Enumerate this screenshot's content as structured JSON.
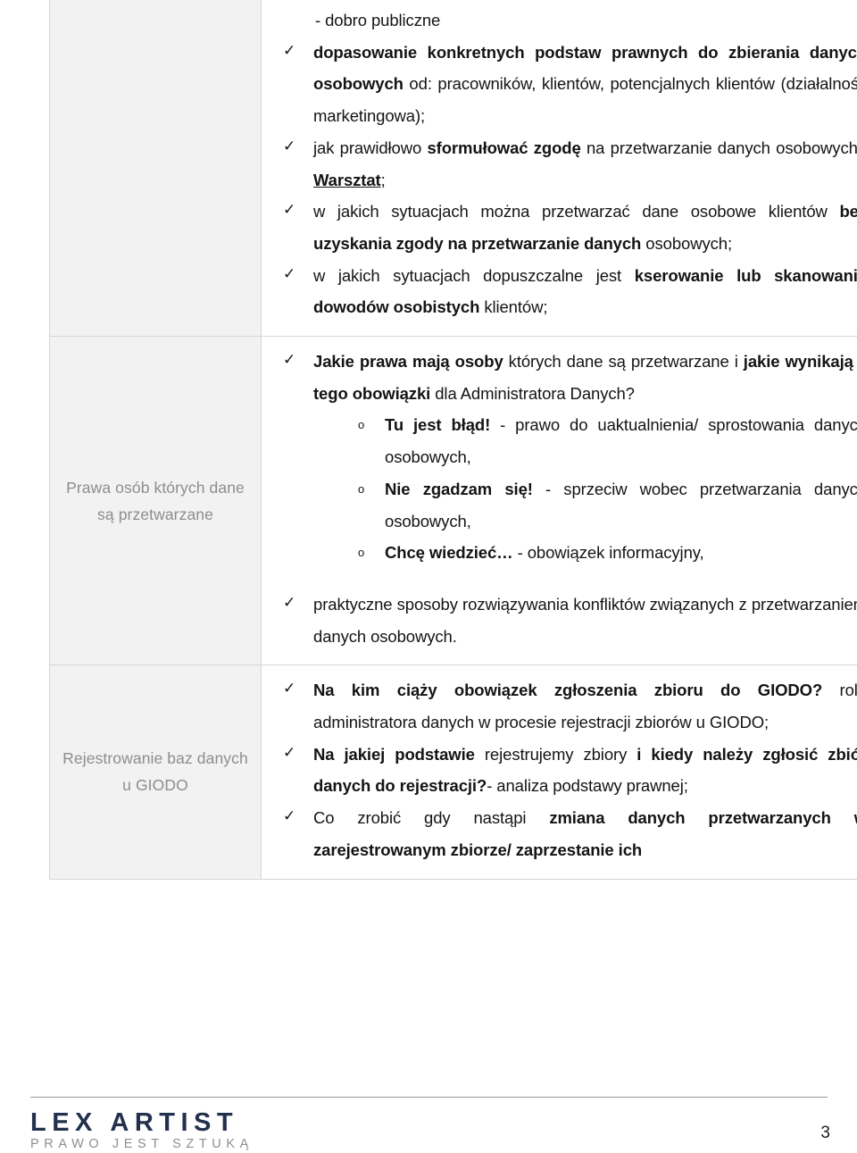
{
  "document": {
    "page_number": "3",
    "footer": {
      "logo_main": "LEX ARTIST",
      "logo_sub": "PRAWO JEST SZTUKĄ"
    }
  },
  "table": {
    "rows": [
      {
        "label": "",
        "blocks": [
          {
            "kind": "plain",
            "text": "- dobro publiczne"
          },
          {
            "kind": "bullet",
            "mark": "✓",
            "segments": [
              {
                "bold": true,
                "text": "dopasowanie konkretnych podstaw prawnych do zbierania danych osobowych"
              },
              {
                "bold": false,
                "text": " od: pracowników, klientów, potencjalnych klientów (działalność marketingowa);"
              }
            ]
          },
          {
            "kind": "bullet",
            "mark": "✓",
            "segments": [
              {
                "bold": false,
                "text": "jak prawidłowo "
              },
              {
                "bold": true,
                "text": "sformułować zgodę"
              },
              {
                "bold": false,
                "text": " na przetwarzanie danych osobowych? "
              },
              {
                "underline": true,
                "text": "Warsztat"
              },
              {
                "bold": false,
                "text": ";"
              }
            ]
          },
          {
            "kind": "bullet",
            "mark": "✓",
            "segments": [
              {
                "bold": false,
                "text": "w jakich sytuacjach można przetwarzać dane osobowe klientów "
              },
              {
                "bold": true,
                "text": "bez uzyskania zgody na przetwarzanie danych"
              },
              {
                "bold": false,
                "text": " osobowych;"
              }
            ]
          },
          {
            "kind": "bullet",
            "mark": "✓",
            "segments": [
              {
                "bold": false,
                "text": "w jakich sytuacjach dopuszczalne jest "
              },
              {
                "bold": true,
                "text": "kserowanie lub skanowanie dowodów osobistych"
              },
              {
                "bold": false,
                "text": " klientów;"
              }
            ]
          }
        ]
      },
      {
        "label": "Prawa osób których dane są przetwarzane",
        "blocks": [
          {
            "kind": "bullet",
            "mark": "✓",
            "segments": [
              {
                "bold": true,
                "text": "Jakie prawa mają osoby"
              },
              {
                "bold": false,
                "text": " których dane są przetwarzane i "
              },
              {
                "bold": true,
                "text": "jakie wynikają z tego obowiązki"
              },
              {
                "bold": false,
                "text": " dla Administratora Danych?"
              }
            ]
          },
          {
            "kind": "sub",
            "mark": "o",
            "segments": [
              {
                "bold": true,
                "text": "Tu jest błąd!"
              },
              {
                "bold": false,
                "text": " - prawo do uaktualnienia/ sprostowania danych osobowych,"
              }
            ]
          },
          {
            "kind": "sub",
            "mark": "o",
            "segments": [
              {
                "bold": true,
                "text": "Nie zgadzam się!"
              },
              {
                "bold": false,
                "text": " - sprzeciw wobec przetwarzania danych osobowych,"
              }
            ]
          },
          {
            "kind": "sub",
            "mark": "o",
            "segments": [
              {
                "bold": true,
                "text": "Chcę wiedzieć…"
              },
              {
                "bold": false,
                "text": " - obowiązek informacyjny,"
              }
            ]
          },
          {
            "kind": "spacer"
          },
          {
            "kind": "bullet",
            "mark": "✓",
            "segments": [
              {
                "bold": false,
                "text": "praktyczne sposoby rozwiązywania konfliktów związanych z przetwarzaniem danych osobowych."
              }
            ]
          }
        ]
      },
      {
        "label": "Rejestrowanie baz danych u GIODO",
        "blocks": [
          {
            "kind": "bullet",
            "mark": "✓",
            "segments": [
              {
                "bold": true,
                "text": "Na kim ciąży obowiązek zgłoszenia zbioru do GIODO?"
              },
              {
                "bold": false,
                "text": " rola administratora danych w procesie rejestracji zbiorów u GIODO;"
              }
            ]
          },
          {
            "kind": "bullet",
            "mark": "✓",
            "segments": [
              {
                "bold": true,
                "text": "Na jakiej podstawie"
              },
              {
                "bold": false,
                "text": " rejestrujemy zbiory "
              },
              {
                "bold": true,
                "text": "i kiedy należy zgłosić zbiór danych do rejestracji?"
              },
              {
                "bold": false,
                "text": "- analiza podstawy prawnej;"
              }
            ]
          },
          {
            "kind": "bullet",
            "mark": "✓",
            "segments": [
              {
                "bold": false,
                "text": "Co zrobić gdy nastąpi "
              },
              {
                "bold": true,
                "text": "zmiana danych przetwarzanych w zarejestrowanym zbiorze/ zaprzestanie ich"
              }
            ]
          }
        ]
      }
    ]
  }
}
